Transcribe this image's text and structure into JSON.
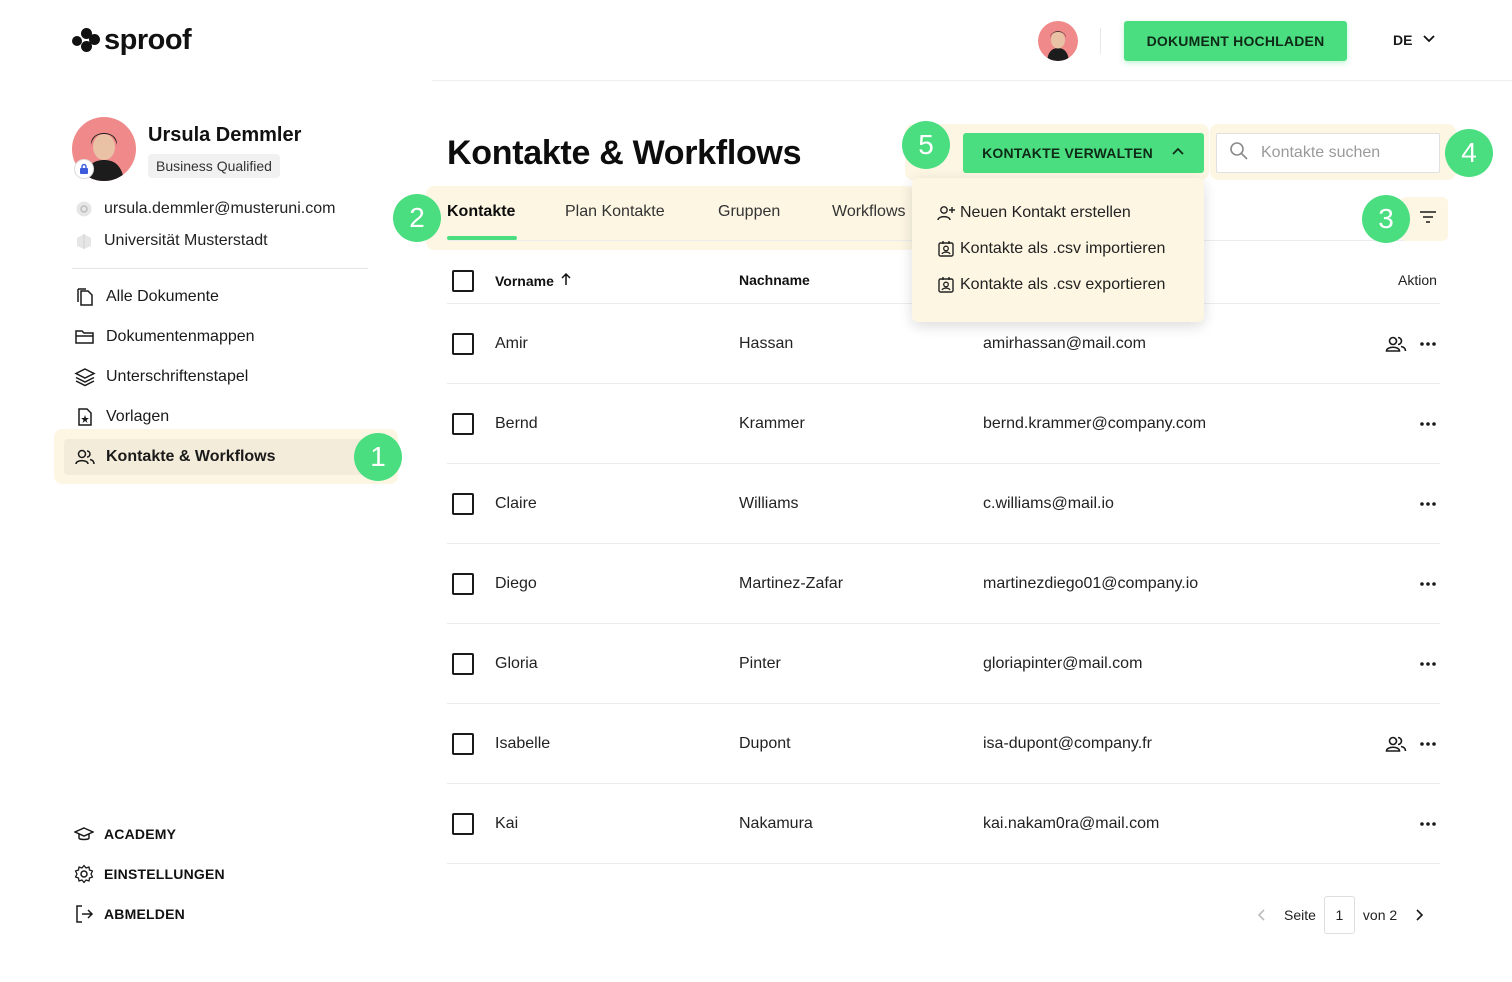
{
  "app": {
    "logo_text": "sproof"
  },
  "header": {
    "upload_label": "DOKUMENT HOCHLADEN",
    "language": "DE"
  },
  "profile": {
    "name": "Ursula Demmler",
    "badge": "Business Qualified",
    "email": "ursula.demmler@musteruni.com",
    "organization": "Universität Musterstadt"
  },
  "sidebar": {
    "items": [
      {
        "label": "Alle Dokumente",
        "icon": "document-icon"
      },
      {
        "label": "Dokumentenmappen",
        "icon": "folder-icon"
      },
      {
        "label": "Unterschriftenstapel",
        "icon": "stack-icon"
      },
      {
        "label": "Vorlagen",
        "icon": "template-icon"
      },
      {
        "label": "Kontakte & Workflows",
        "icon": "contacts-icon",
        "active": true
      }
    ],
    "bottom": [
      {
        "label": "ACADEMY",
        "icon": "graduation-cap-icon"
      },
      {
        "label": "EINSTELLUNGEN",
        "icon": "gear-icon"
      },
      {
        "label": "ABMELDEN",
        "icon": "logout-icon"
      }
    ]
  },
  "markers": [
    "1",
    "2",
    "3",
    "4",
    "5"
  ],
  "main": {
    "title": "Kontakte & Workflows",
    "manage_label": "KONTAKTE VERWALTEN",
    "search_placeholder": "Kontakte suchen",
    "tabs": [
      {
        "label": "Kontakte",
        "active": true
      },
      {
        "label": "Plan Kontakte"
      },
      {
        "label": "Gruppen"
      },
      {
        "label": "Workflows"
      }
    ],
    "dropdown": [
      {
        "label": "Neuen Kontakt erstellen",
        "icon": "add-user-icon"
      },
      {
        "label": "Kontakte als .csv importieren",
        "icon": "import-icon"
      },
      {
        "label": "Kontakte als .csv exportieren",
        "icon": "export-icon"
      }
    ]
  },
  "table": {
    "columns": {
      "firstname": "Vorname",
      "lastname": "Nachname",
      "action": "Aktion"
    },
    "rows": [
      {
        "first": "Amir",
        "last": "Hassan",
        "email": "amirhassan@mail.com",
        "group": true
      },
      {
        "first": "Bernd",
        "last": "Krammer",
        "email": "bernd.krammer@company.com",
        "group": false
      },
      {
        "first": "Claire",
        "last": "Williams",
        "email": "c.williams@mail.io",
        "group": false
      },
      {
        "first": "Diego",
        "last": "Martinez-Zafar",
        "email": "martinezdiego01@company.io",
        "group": false
      },
      {
        "first": "Gloria",
        "last": "Pinter",
        "email": "gloriapinter@mail.com",
        "group": false
      },
      {
        "first": "Isabelle",
        "last": "Dupont",
        "email": "isa-dupont@company.fr",
        "group": true
      },
      {
        "first": "Kai",
        "last": "Nakamura",
        "email": "kai.nakam0ra@mail.com",
        "group": false
      }
    ]
  },
  "pagination": {
    "page_label": "Seite",
    "current": "1",
    "of_label": "von 2"
  },
  "colors": {
    "accent": "#4ade80",
    "highlight": "#fdf6e3",
    "text": "#1a1a1a"
  }
}
